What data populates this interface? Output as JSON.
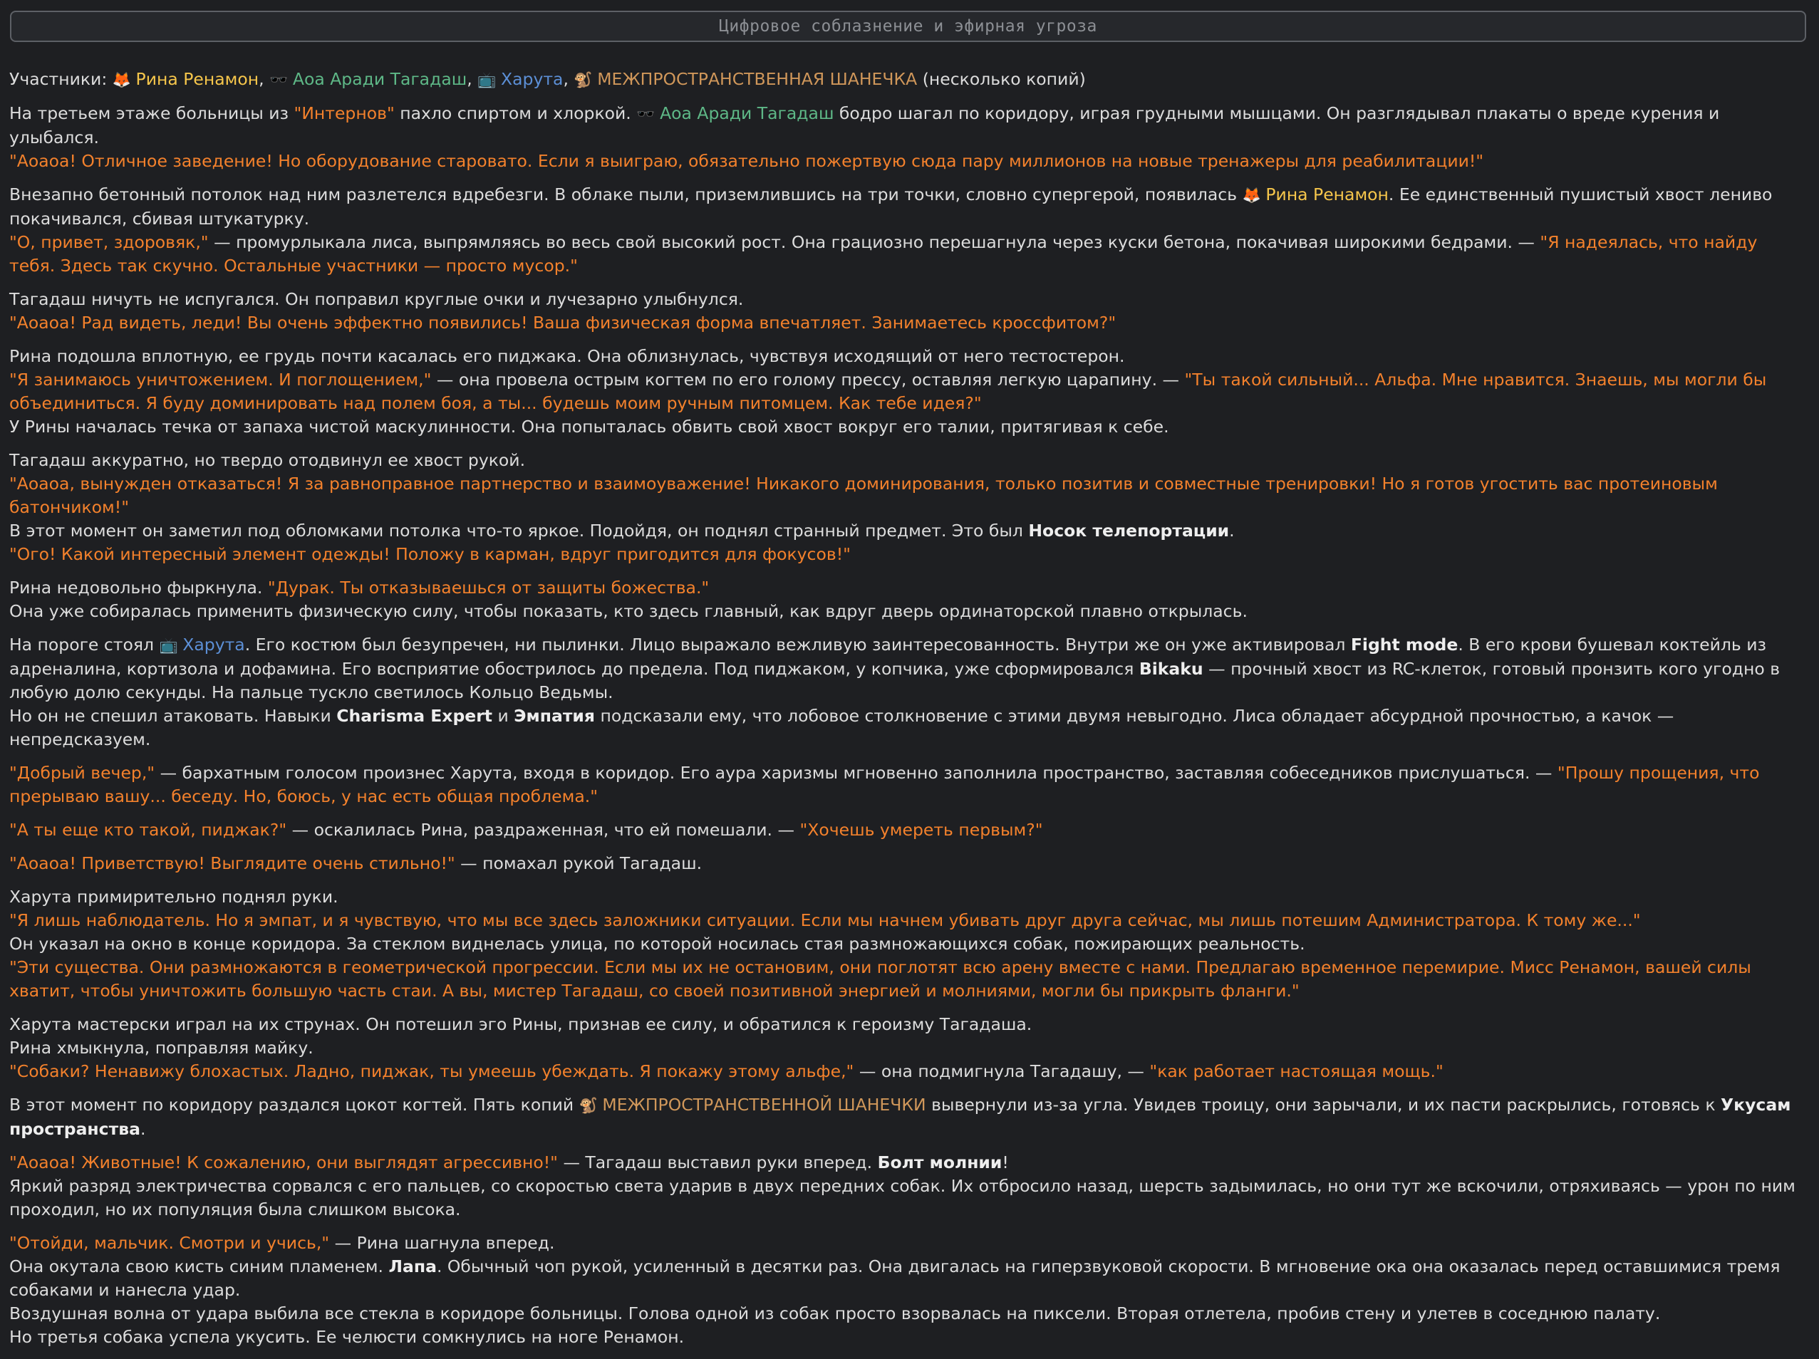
{
  "title": "Цифровое соблазнение и эфирная угроза",
  "paragraphs": [
    {
      "lines": [
        [
          [
            "t",
            "Участники: "
          ],
          [
            "e",
            "🦊 "
          ],
          [
            "rina",
            "Рина Ренамон"
          ],
          [
            "t",
            ", "
          ],
          [
            "e",
            "🕶️ "
          ],
          [
            "aoa",
            "Аоа Аради Тагадаш"
          ],
          [
            "t",
            ", "
          ],
          [
            "e",
            "📺 "
          ],
          [
            "haruta",
            "Харута"
          ],
          [
            "t",
            ", "
          ],
          [
            "e",
            "🐒 "
          ],
          [
            "shan",
            "МЕЖПРОСТРАНСТВЕННАЯ ШАНЕЧКА"
          ],
          [
            "t",
            " (несколько копий)"
          ]
        ]
      ]
    },
    {
      "lines": [
        [
          [
            "t",
            "На третьем этаже больницы из "
          ],
          [
            "hl",
            "\"Интернов\""
          ],
          [
            "t",
            " пахло спиртом и хлоркой. "
          ],
          [
            "e",
            "🕶️ "
          ],
          [
            "aoa",
            "Аоа Аради Тагадаш"
          ],
          [
            "t",
            " бодро шагал по коридору, играя грудными мышцами. Он разглядывал плакаты о вреде курения и улыбался."
          ]
        ],
        [
          [
            "q",
            "\"Аоаоа! Отличное заведение! Но оборудование старовато. Если я выиграю, обязательно пожертвую сюда пару миллионов на новые тренажеры для реабилитации!\""
          ]
        ]
      ]
    },
    {
      "lines": [
        [
          [
            "t",
            "Внезапно бетонный потолок над ним разлетелся вдребезги. В облаке пыли, приземлившись на три точки, словно супергерой, появилась "
          ],
          [
            "e",
            "🦊 "
          ],
          [
            "rina",
            "Рина Ренамон"
          ],
          [
            "t",
            ". Ее единственный пушистый хвост лениво покачивался, сбивая штукатурку."
          ]
        ],
        [
          [
            "q",
            "\"О, привет, здоровяк,\""
          ],
          [
            "t",
            " — промурлыкала лиса, выпрямляясь во весь свой высокий рост. Она грациозно перешагнула через куски бетона, покачивая широкими бедрами. — "
          ],
          [
            "q",
            "\"Я надеялась, что найду тебя. Здесь так скучно. Остальные участники — просто мусор.\""
          ]
        ]
      ]
    },
    {
      "lines": [
        [
          [
            "t",
            "Тагадаш ничуть не испугался. Он поправил круглые очки и лучезарно улыбнулся."
          ]
        ],
        [
          [
            "q",
            "\"Аоаоа! Рад видеть, леди! Вы очень эффектно появились! Ваша физическая форма впечатляет. Занимаетесь кроссфитом?\""
          ]
        ]
      ]
    },
    {
      "lines": [
        [
          [
            "t",
            "Рина подошла вплотную, ее грудь почти касалась его пиджака. Она облизнулась, чувствуя исходящий от него тестостерон."
          ]
        ],
        [
          [
            "q",
            "\"Я занимаюсь уничтожением. И поглощением,\""
          ],
          [
            "t",
            " — она провела острым когтем по его голому прессу, оставляя легкую царапину. — "
          ],
          [
            "q",
            "\"Ты такой сильный... Альфа. Мне нравится. Знаешь, мы могли бы объединиться. Я буду доминировать над полем боя, а ты... будешь моим ручным питомцем. Как тебе идея?\""
          ]
        ],
        [
          [
            "t",
            "У Рины началась течка от запаха чистой маскулинности. Она попыталась обвить свой хвост вокруг его талии, притягивая к себе."
          ]
        ]
      ]
    },
    {
      "lines": [
        [
          [
            "t",
            "Тагадаш аккуратно, но твердо отодвинул ее хвост рукой."
          ]
        ],
        [
          [
            "q",
            "\"Аоаоа, вынужден отказаться! Я за равноправное партнерство и взаимоуважение! Никакого доминирования, только позитив и совместные тренировки! Но я готов угостить вас протеиновым батончиком!\""
          ]
        ],
        [
          [
            "t",
            "В этот момент он заметил под обломками потолка что-то яркое. Подойдя, он поднял странный предмет. Это был "
          ],
          [
            "b",
            "Носок телепортации"
          ],
          [
            "t",
            "."
          ]
        ],
        [
          [
            "q",
            "\"Ого! Какой интересный элемент одежды! Положу в карман, вдруг пригодится для фокусов!\""
          ]
        ]
      ]
    },
    {
      "lines": [
        [
          [
            "t",
            "Рина недовольно фыркнула. "
          ],
          [
            "q",
            "\"Дурак. Ты отказываешься от защиты божества.\""
          ]
        ],
        [
          [
            "t",
            "Она уже собиралась применить физическую силу, чтобы показать, кто здесь главный, как вдруг дверь ординаторской плавно открылась."
          ]
        ]
      ]
    },
    {
      "lines": [
        [
          [
            "t",
            "На пороге стоял "
          ],
          [
            "e",
            "📺 "
          ],
          [
            "haruta",
            "Харута"
          ],
          [
            "t",
            ". Его костюм был безупречен, ни пылинки. Лицо выражало вежливую заинтересованность. Внутри же он уже активировал "
          ],
          [
            "b",
            "Fight mode"
          ],
          [
            "t",
            ". В его крови бушевал коктейль из адреналина, кортизола и дофамина. Его восприятие обострилось до предела. Под пиджаком, у копчика, уже сформировался "
          ],
          [
            "b",
            "Bikaku"
          ],
          [
            "t",
            " — прочный хвост из RC-клеток, готовый пронзить кого угодно в любую долю секунды. На пальце тускло светилось Кольцо Ведьмы."
          ]
        ],
        [
          [
            "t",
            "Но он не спешил атаковать. Навыки "
          ],
          [
            "b",
            "Charisma Expert"
          ],
          [
            "t",
            " и "
          ],
          [
            "b",
            "Эмпатия"
          ],
          [
            "t",
            " подсказали ему, что лобовое столкновение с этими двумя невыгодно. Лиса обладает абсурдной прочностью, а качок — непредсказуем."
          ]
        ]
      ]
    },
    {
      "lines": [
        [
          [
            "q",
            "\"Добрый вечер,\""
          ],
          [
            "t",
            " — бархатным голосом произнес Харута, входя в коридор. Его аура харизмы мгновенно заполнила пространство, заставляя собеседников прислушаться. — "
          ],
          [
            "q",
            "\"Прошу прощения, что прерываю вашу... беседу. Но, боюсь, у нас есть общая проблема.\""
          ]
        ]
      ]
    },
    {
      "lines": [
        [
          [
            "q",
            "\"А ты еще кто такой, пиджак?\""
          ],
          [
            "t",
            " — оскалилась Рина, раздраженная, что ей помешали. — "
          ],
          [
            "q",
            "\"Хочешь умереть первым?\""
          ]
        ]
      ]
    },
    {
      "lines": [
        [
          [
            "q",
            "\"Аоаоа! Приветствую! Выглядите очень стильно!\""
          ],
          [
            "t",
            " — помахал рукой Тагадаш."
          ]
        ]
      ]
    },
    {
      "lines": [
        [
          [
            "t",
            "Харута примирительно поднял руки."
          ]
        ],
        [
          [
            "q",
            "\"Я лишь наблюдатель. Но я эмпат, и я чувствую, что мы все здесь заложники ситуации. Если мы начнем убивать друг друга сейчас, мы лишь потешим Администратора. К тому же...\""
          ]
        ],
        [
          [
            "t",
            "Он указал на окно в конце коридора. За стеклом виднелась улица, по которой носилась стая размножающихся собак, пожирающих реальность."
          ]
        ],
        [
          [
            "q",
            "\"Эти существа. Они размножаются в геометрической прогрессии. Если мы их не остановим, они поглотят всю арену вместе с нами. Предлагаю временное перемирие. Мисс Ренамон, вашей силы хватит, чтобы уничтожить большую часть стаи. А вы, мистер Тагадаш, со своей позитивной энергией и молниями, могли бы прикрыть фланги.\""
          ]
        ]
      ]
    },
    {
      "lines": [
        [
          [
            "t",
            "Харута мастерски играл на их струнах. Он потешил эго Рины, признав ее силу, и обратился к героизму Тагадаша."
          ]
        ],
        [
          [
            "t",
            "Рина хмыкнула, поправляя майку."
          ]
        ],
        [
          [
            "q",
            "\"Собаки? Ненавижу блохастых. Ладно, пиджак, ты умеешь убеждать. Я покажу этому альфе,\""
          ],
          [
            "t",
            " — она подмигнула Тагадашу, — "
          ],
          [
            "q",
            "\"как работает настоящая мощь.\""
          ]
        ]
      ]
    },
    {
      "lines": [
        [
          [
            "t",
            "В этот момент по коридору раздался цокот когтей. Пять копий "
          ],
          [
            "e",
            "🐒 "
          ],
          [
            "shan",
            "МЕЖПРОСТРАНСТВЕННОЙ ШАНЕЧКИ"
          ],
          [
            "t",
            " вывернули из-за угла. Увидев троицу, они зарычали, и их пасти раскрылись, готовясь к "
          ],
          [
            "b",
            "Укусам пространства"
          ],
          [
            "t",
            "."
          ]
        ]
      ]
    },
    {
      "lines": [
        [
          [
            "q",
            "\"Аоаоа! Животные! К сожалению, они выглядят агрессивно!\""
          ],
          [
            "t",
            " — Тагадаш выставил руки вперед. "
          ],
          [
            "b",
            "Болт молнии"
          ],
          [
            "t",
            "!"
          ]
        ],
        [
          [
            "t",
            "Яркий разряд электричества сорвался с его пальцев, со скоростью света ударив в двух передних собак. Их отбросило назад, шерсть задымилась, но они тут же вскочили, отряхиваясь — урон по ним проходил, но их популяция была слишком высока."
          ]
        ]
      ]
    },
    {
      "lines": [
        [
          [
            "q",
            "\"Отойди, мальчик. Смотри и учись,\""
          ],
          [
            "t",
            " — Рина шагнула вперед."
          ]
        ],
        [
          [
            "t",
            "Она окутала свою кисть синим пламенем. "
          ],
          [
            "b",
            "Лапа"
          ],
          [
            "t",
            ". Обычный чоп рукой, усиленный в десятки раз. Она двигалась на гиперзвуковой скорости. В мгновение ока она оказалась перед оставшимися тремя собаками и нанесла удар."
          ]
        ],
        [
          [
            "t",
            "Воздушная волна от удара выбила все стекла в коридоре больницы. Голова одной из собак просто взорвалась на пиксели. Вторая отлетела, пробив стену и улетев в соседнюю палату."
          ]
        ],
        [
          [
            "t",
            "Но третья собака успела укусить. Ее челюсти сомкнулись на ноге Ренамон."
          ]
        ]
      ]
    }
  ]
}
